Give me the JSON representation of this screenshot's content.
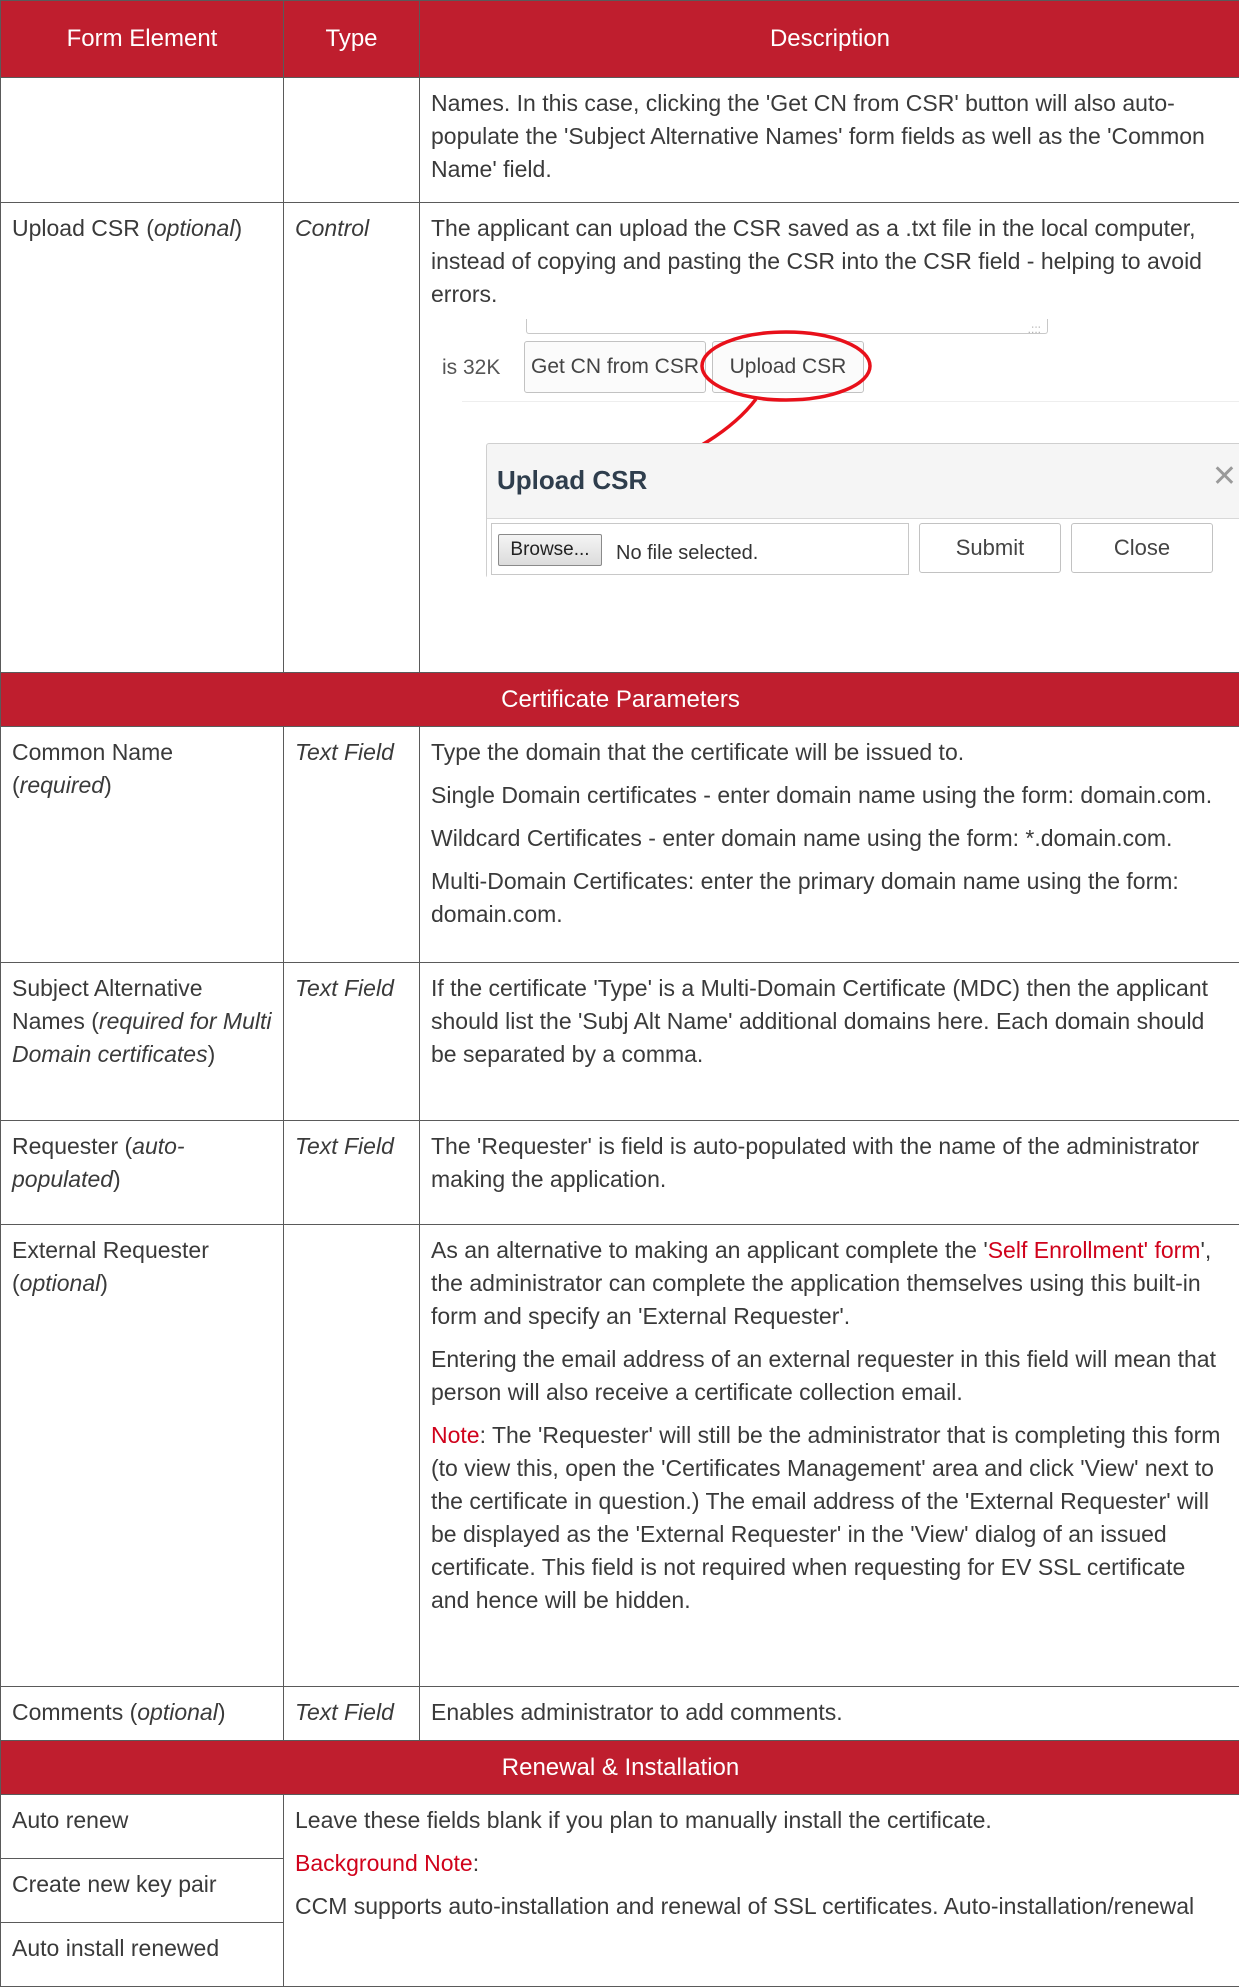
{
  "header": {
    "col1": "Form Element",
    "col2": "Type",
    "col3": "Description"
  },
  "row_names_cont": {
    "text": "Names. In this case, clicking the 'Get CN from CSR' button will also auto-populate the 'Subject Alternative Names' form fields as well as the 'Common Name' field."
  },
  "row_upload": {
    "element_name": "Upload CSR (",
    "element_qualifier": "optional",
    "element_close": ")",
    "type": "Control",
    "description": "The applicant can upload the CSR saved as a .txt file in the local computer, instead of copying and pasting the CSR into the CSR field - helping to avoid errors.",
    "screenshot": {
      "size_text": "is 32K",
      "get_cn_button": "Get CN from CSR",
      "upload_button": "Upload CSR",
      "annotation_color": "#e8101a",
      "dialog": {
        "title": "Upload CSR",
        "close_icon": "close-x",
        "browse_button": "Browse...",
        "file_status": "No file selected.",
        "submit_button": "Submit",
        "close_button": "Close"
      }
    }
  },
  "section_cert_params": "Certificate Parameters",
  "row_common_name": {
    "element_name": "Common Name",
    "element_open": "(",
    "element_qualifier": "required",
    "element_close": ")",
    "type": "Text Field",
    "p1": "Type the domain that the certificate will be issued to.",
    "p2": "Single Domain certificates - enter domain name using the form: domain.com.",
    "p3": "Wildcard Certificates - enter domain name using the form: *.domain.com.",
    "p4": "Multi-Domain Certificates: enter the primary domain name using the form: domain.com."
  },
  "row_san": {
    "element_name": "Subject Alternative Names (",
    "element_qualifier": "required for Multi Domain certificates",
    "element_close": ")",
    "type": "Text Field",
    "description": "If the certificate 'Type' is a Multi-Domain Certificate (MDC) then the applicant should list the 'Subj Alt Name' additional domains here. Each domain should be separated by a comma."
  },
  "row_requester": {
    "element_name": "Requester (",
    "element_qualifier": "auto-populated",
    "element_close": ")",
    "type": "Text Field",
    "description": "The 'Requester' is field is auto-populated with the name of the administrator making the application."
  },
  "row_ext_requester": {
    "element_name": "External Requester",
    "element_open": "(",
    "element_qualifier": "optional",
    "element_close": ")",
    "p1_before": "As an alternative to making an applicant complete the '",
    "p1_link": "Self Enrollment' form",
    "p1_after": "', the administrator can complete the application themselves using this built-in form and specify an 'External Requester'.",
    "p2": "Entering the email address of an external requester in this field will mean that person will also receive a certificate collection email.",
    "note_label": "Note",
    "note_text": ": The 'Requester' will still be the administrator that is completing this form (to view this, open the 'Certificates Management' area and click 'View' next to the certificate in question.) The email address of the 'External Requester' will be displayed as the 'External Requester' in the 'View' dialog of an issued certificate. This field is not required when requesting for EV SSL certificate and hence will be hidden."
  },
  "row_comments": {
    "element_name": "Comments (",
    "element_qualifier": "optional",
    "element_close": ")",
    "type": "Text Field",
    "description": "Enables administrator to add comments."
  },
  "section_renewal": "Renewal & Installation",
  "row_renewal": {
    "items": [
      "Auto renew",
      "Create new key pair",
      "Auto install renewed"
    ],
    "p1": "Leave these fields blank if you plan to manually install the certificate.",
    "bg_label": "Background Note",
    "bg_colon": ":",
    "p2": "CCM supports auto-installation and renewal of SSL certificates. Auto-installation/renewal"
  },
  "colors": {
    "header_bg": "#bf1e2e",
    "header_text": "#ffffff",
    "link_red": "#d0021b"
  }
}
